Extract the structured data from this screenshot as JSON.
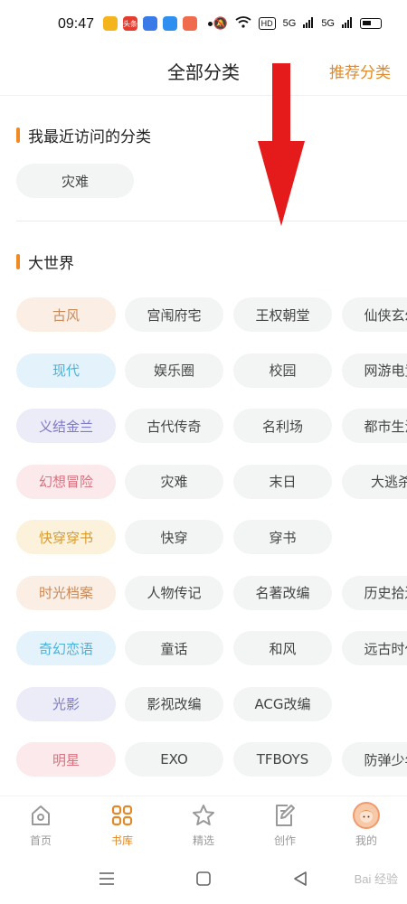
{
  "status_bar": {
    "time": "09:47",
    "app_icons": [
      {
        "name": "notes-app-icon",
        "color": "#f3b51b"
      },
      {
        "name": "news-app-icon",
        "color": "#e63c30",
        "text": "头条"
      },
      {
        "name": "baidu-app-icon",
        "color": "#3a7ae8"
      },
      {
        "name": "browser-app-icon",
        "color": "#2f8ff0"
      },
      {
        "name": "shop-app-icon",
        "color": "#f06a4c"
      }
    ],
    "network_badge": "HD",
    "signal_1": "5G",
    "signal_2": "5G"
  },
  "header": {
    "title": "全部分类",
    "recommend_link": "推荐分类"
  },
  "recent_section": {
    "title": "我最近访问的分类",
    "chips": [
      "灾难"
    ]
  },
  "world_section": {
    "title": "大世界",
    "rows": [
      {
        "primary": "古风",
        "primary_bg": "#fbeee4",
        "primary_color": "#c98a5a",
        "items": [
          "宫闱府宅",
          "王权朝堂",
          "仙侠玄幻"
        ]
      },
      {
        "primary": "现代",
        "primary_bg": "#e4f3fb",
        "primary_color": "#4db0d6",
        "items": [
          "娱乐圈",
          "校园",
          "网游电竞"
        ]
      },
      {
        "primary": "义结金兰",
        "primary_bg": "#ecebf8",
        "primary_color": "#7e7ac8",
        "items": [
          "古代传奇",
          "名利场",
          "都市生活"
        ]
      },
      {
        "primary": "幻想冒险",
        "primary_bg": "#fbe9ec",
        "primary_color": "#d9727e",
        "items": [
          "灾难",
          "末日",
          "大逃杀"
        ]
      },
      {
        "primary": "快穿穿书",
        "primary_bg": "#fcf2dc",
        "primary_color": "#d99a2a",
        "items": [
          "快穿",
          "穿书"
        ]
      },
      {
        "primary": "时光档案",
        "primary_bg": "#fbeee4",
        "primary_color": "#c98a5a",
        "items": [
          "人物传记",
          "名著改编",
          "历史拾遗"
        ]
      },
      {
        "primary": "奇幻恋语",
        "primary_bg": "#e4f3fb",
        "primary_color": "#4db0d6",
        "items": [
          "童话",
          "和风",
          "远古时代"
        ]
      },
      {
        "primary": "光影",
        "primary_bg": "#ecebf8",
        "primary_color": "#7e7ac8",
        "items": [
          "影视改编",
          "ACG改编"
        ]
      },
      {
        "primary": "明星",
        "primary_bg": "#fbe9ec",
        "primary_color": "#d9727e",
        "items": [
          "EXO",
          "TFBOYS",
          "防弹少年"
        ]
      }
    ]
  },
  "bottom_nav": {
    "items": [
      {
        "label": "首页",
        "icon": "home-icon",
        "active": false
      },
      {
        "label": "书库",
        "icon": "grid-icon",
        "active": true
      },
      {
        "label": "精选",
        "icon": "star-icon",
        "active": false
      },
      {
        "label": "创作",
        "icon": "edit-icon",
        "active": false
      },
      {
        "label": "我的",
        "icon": "avatar-icon",
        "active": false
      }
    ]
  },
  "system_nav": {
    "watermark": "Bai 经验"
  },
  "colors": {
    "accent": "#e08a2a",
    "section_bar": "#f08a24",
    "chip_bg": "#f3f5f5",
    "arrow": "#e51b1b"
  }
}
